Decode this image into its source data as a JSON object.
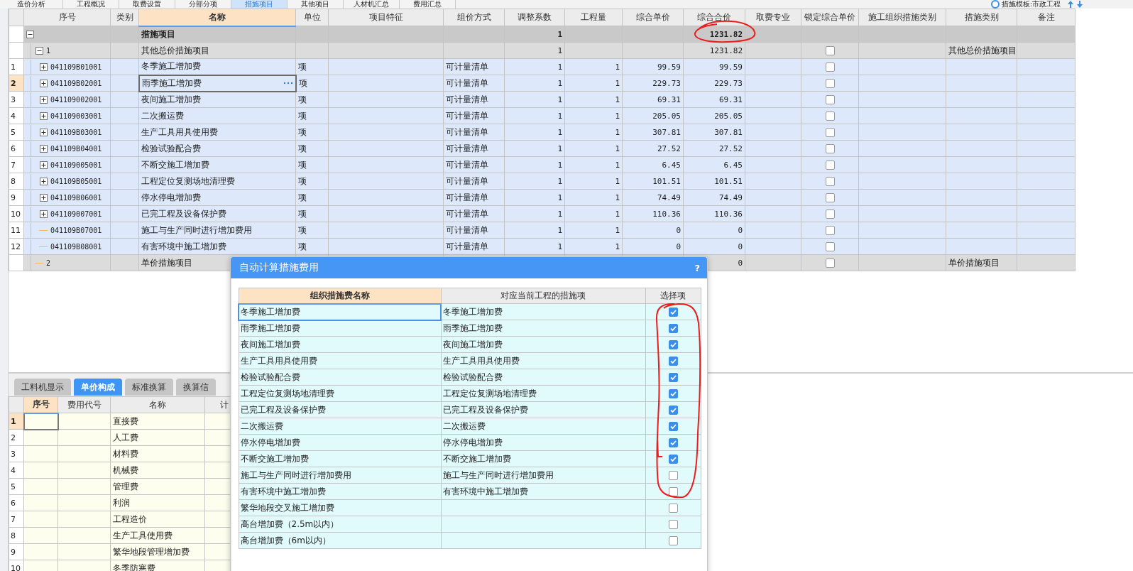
{
  "tabs": [
    {
      "label": "造价分析",
      "selected": false
    },
    {
      "label": "工程概况",
      "selected": false
    },
    {
      "label": "取费设置",
      "selected": false
    },
    {
      "label": "分部分项",
      "selected": false
    },
    {
      "label": "措施项目",
      "selected": true
    },
    {
      "label": "其他项目",
      "selected": false
    },
    {
      "label": "人材机汇总",
      "selected": false
    },
    {
      "label": "费用汇总",
      "selected": false
    }
  ],
  "template": {
    "label": "措施模板:市政工程"
  },
  "measures_grid": {
    "columns": [
      {
        "label": "序号",
        "current": false
      },
      {
        "label": "类别",
        "current": false
      },
      {
        "label": "名称",
        "current": true
      },
      {
        "label": "单位",
        "current": false
      },
      {
        "label": "项目特征",
        "current": false
      },
      {
        "label": "组价方式",
        "current": false
      },
      {
        "label": "调整系数",
        "current": false
      },
      {
        "label": "工程量",
        "current": false
      },
      {
        "label": "综合单价",
        "current": false
      },
      {
        "label": "综合合价",
        "current": false
      },
      {
        "label": "取费专业",
        "current": false
      },
      {
        "label": "锁定综合单价",
        "current": false
      },
      {
        "label": "施工组织措施类别",
        "current": false
      },
      {
        "label": "措施类别",
        "current": false
      },
      {
        "label": "备注",
        "current": false
      }
    ],
    "rows": [
      {
        "kind": "group",
        "name": "措施项目",
        "adjust": "1",
        "total": "1231.82",
        "expanded": true,
        "children": [
          {
            "kind": "subgroup",
            "code": "1",
            "name": "其他总价措施项目",
            "adjust": "1",
            "total": "1231.82",
            "locked": false,
            "measure_type": "其他总价措施项目",
            "expanded": true,
            "children": [
              {
                "kind": "item",
                "index": "1",
                "code": "041109B01001",
                "name": "冬季施工增加费",
                "unit": "项",
                "pricing": "可计量清单",
                "adjust": "1",
                "quantity": "1",
                "unit_price": "99.59",
                "total": "99.59",
                "locked": false,
                "expanded": false,
                "selected": false
              },
              {
                "kind": "item",
                "index": "2",
                "code": "041109B02001",
                "name": "雨季施工增加费",
                "unit": "项",
                "pricing": "可计量清单",
                "adjust": "1",
                "quantity": "1",
                "unit_price": "229.73",
                "total": "229.73",
                "locked": false,
                "expanded": false,
                "selected": true
              },
              {
                "kind": "item",
                "index": "3",
                "code": "041109002001",
                "name": "夜间施工增加费",
                "unit": "项",
                "pricing": "可计量清单",
                "adjust": "1",
                "quantity": "1",
                "unit_price": "69.31",
                "total": "69.31",
                "locked": false,
                "expanded": false,
                "selected": false
              },
              {
                "kind": "item",
                "index": "4",
                "code": "041109003001",
                "name": "二次搬运费",
                "unit": "项",
                "pricing": "可计量清单",
                "adjust": "1",
                "quantity": "1",
                "unit_price": "205.05",
                "total": "205.05",
                "locked": false,
                "expanded": false,
                "selected": false
              },
              {
                "kind": "item",
                "index": "5",
                "code": "041109B03001",
                "name": "生产工具用具使用费",
                "unit": "项",
                "pricing": "可计量清单",
                "adjust": "1",
                "quantity": "1",
                "unit_price": "307.81",
                "total": "307.81",
                "locked": false,
                "expanded": false,
                "selected": false
              },
              {
                "kind": "item",
                "index": "6",
                "code": "041109B04001",
                "name": "检验试验配合费",
                "unit": "项",
                "pricing": "可计量清单",
                "adjust": "1",
                "quantity": "1",
                "unit_price": "27.52",
                "total": "27.52",
                "locked": false,
                "expanded": false,
                "selected": false
              },
              {
                "kind": "item",
                "index": "7",
                "code": "041109005001",
                "name": "不断交施工增加费",
                "unit": "项",
                "pricing": "可计量清单",
                "adjust": "1",
                "quantity": "1",
                "unit_price": "6.45",
                "total": "6.45",
                "locked": false,
                "expanded": false,
                "selected": false
              },
              {
                "kind": "item",
                "index": "8",
                "code": "041109B05001",
                "name": "工程定位复测场地清理费",
                "unit": "项",
                "pricing": "可计量清单",
                "adjust": "1",
                "quantity": "1",
                "unit_price": "101.51",
                "total": "101.51",
                "locked": false,
                "expanded": false,
                "selected": false
              },
              {
                "kind": "item",
                "index": "9",
                "code": "041109B06001",
                "name": "停水停电增加费",
                "unit": "项",
                "pricing": "可计量清单",
                "adjust": "1",
                "quantity": "1",
                "unit_price": "74.49",
                "total": "74.49",
                "locked": false,
                "expanded": false,
                "selected": false
              },
              {
                "kind": "item",
                "index": "10",
                "code": "041109007001",
                "name": "已完工程及设备保护费",
                "unit": "项",
                "pricing": "可计量清单",
                "adjust": "1",
                "quantity": "1",
                "unit_price": "110.36",
                "total": "110.36",
                "locked": false,
                "expanded": false,
                "selected": false
              },
              {
                "kind": "item",
                "index": "11",
                "code": "041109B07001",
                "name": "施工与生产同时进行增加费用",
                "unit": "项",
                "pricing": "可计量清单",
                "adjust": "1",
                "quantity": "1",
                "unit_price": "0",
                "total": "0",
                "locked": false,
                "selected": false
              },
              {
                "kind": "item",
                "index": "12",
                "code": "041109B08001",
                "name": "有害环境中施工增加费",
                "unit": "项",
                "pricing": "可计量清单",
                "adjust": "1",
                "quantity": "1",
                "unit_price": "0",
                "total": "0",
                "locked": false,
                "selected": false
              }
            ]
          },
          {
            "kind": "subgroup",
            "code": "2",
            "name": "单价措施项目",
            "total": "0",
            "locked": false,
            "measure_type": "单价措施项目"
          }
        ]
      }
    ]
  },
  "detail_tabs": [
    {
      "label": "工料机显示",
      "selected": false
    },
    {
      "label": "单价构成",
      "selected": true
    },
    {
      "label": "标准换算",
      "selected": false
    },
    {
      "label": "换算信",
      "selected": false
    }
  ],
  "unit_price_grid": {
    "columns": [
      {
        "label": "序号",
        "current": true
      },
      {
        "label": "费用代号",
        "current": false
      },
      {
        "label": "名称",
        "current": false
      },
      {
        "label": "计",
        "current": false
      }
    ],
    "rows": [
      {
        "index": "1",
        "name": "直接费",
        "selected": true
      },
      {
        "index": "2",
        "name": "人工费",
        "selected": false
      },
      {
        "index": "3",
        "name": "材料费",
        "selected": false
      },
      {
        "index": "4",
        "name": "机械费",
        "selected": false
      },
      {
        "index": "5",
        "name": "管理费",
        "selected": false
      },
      {
        "index": "6",
        "name": "利润",
        "selected": false
      },
      {
        "index": "7",
        "name": "工程造价",
        "selected": false
      },
      {
        "index": "8",
        "name": "生产工具使用费",
        "selected": false
      },
      {
        "index": "9",
        "name": "繁华地段管理增加费",
        "selected": false
      },
      {
        "index": "10",
        "name": "冬季防寒费",
        "selected": false
      }
    ]
  },
  "dialog": {
    "title": "自动计算措施费用",
    "help": "?",
    "columns": [
      {
        "label": "组织措施费名称",
        "current": true
      },
      {
        "label": "对应当前工程的措施项",
        "current": false
      },
      {
        "label": "选择项",
        "current": false
      }
    ],
    "rows": [
      {
        "name": "冬季施工增加费",
        "measure": "冬季施工增加费",
        "checked": true,
        "selected": true
      },
      {
        "name": "雨季施工增加费",
        "measure": "雨季施工增加费",
        "checked": true,
        "selected": false
      },
      {
        "name": "夜间施工增加费",
        "measure": "夜间施工增加费",
        "checked": true,
        "selected": false
      },
      {
        "name": "生产工具用具使用费",
        "measure": "生产工具用具使用费",
        "checked": true,
        "selected": false
      },
      {
        "name": "检验试验配合费",
        "measure": "检验试验配合费",
        "checked": true,
        "selected": false
      },
      {
        "name": "工程定位复测场地清理费",
        "measure": "工程定位复测场地清理费",
        "checked": true,
        "selected": false
      },
      {
        "name": "已完工程及设备保护费",
        "measure": "已完工程及设备保护费",
        "checked": true,
        "selected": false
      },
      {
        "name": "二次搬运费",
        "measure": "二次搬运费",
        "checked": true,
        "selected": false
      },
      {
        "name": "停水停电增加费",
        "measure": "停水停电增加费",
        "checked": true,
        "selected": false
      },
      {
        "name": "不断交施工增加费",
        "measure": "不断交施工增加费",
        "checked": true,
        "selected": false
      },
      {
        "name": "施工与生产同时进行增加费用",
        "measure": "施工与生产同时进行增加费用",
        "checked": false,
        "selected": false
      },
      {
        "name": "有害环境中施工增加费",
        "measure": "有害环境中施工增加费",
        "checked": false,
        "selected": false
      },
      {
        "name": "繁华地段交叉施工增加费",
        "checked": false,
        "selected": false
      },
      {
        "name": "高台增加费（2.5m以内）",
        "checked": false,
        "selected": false
      },
      {
        "name": "高台增加费（6m以内）",
        "checked": false,
        "selected": false
      }
    ]
  }
}
